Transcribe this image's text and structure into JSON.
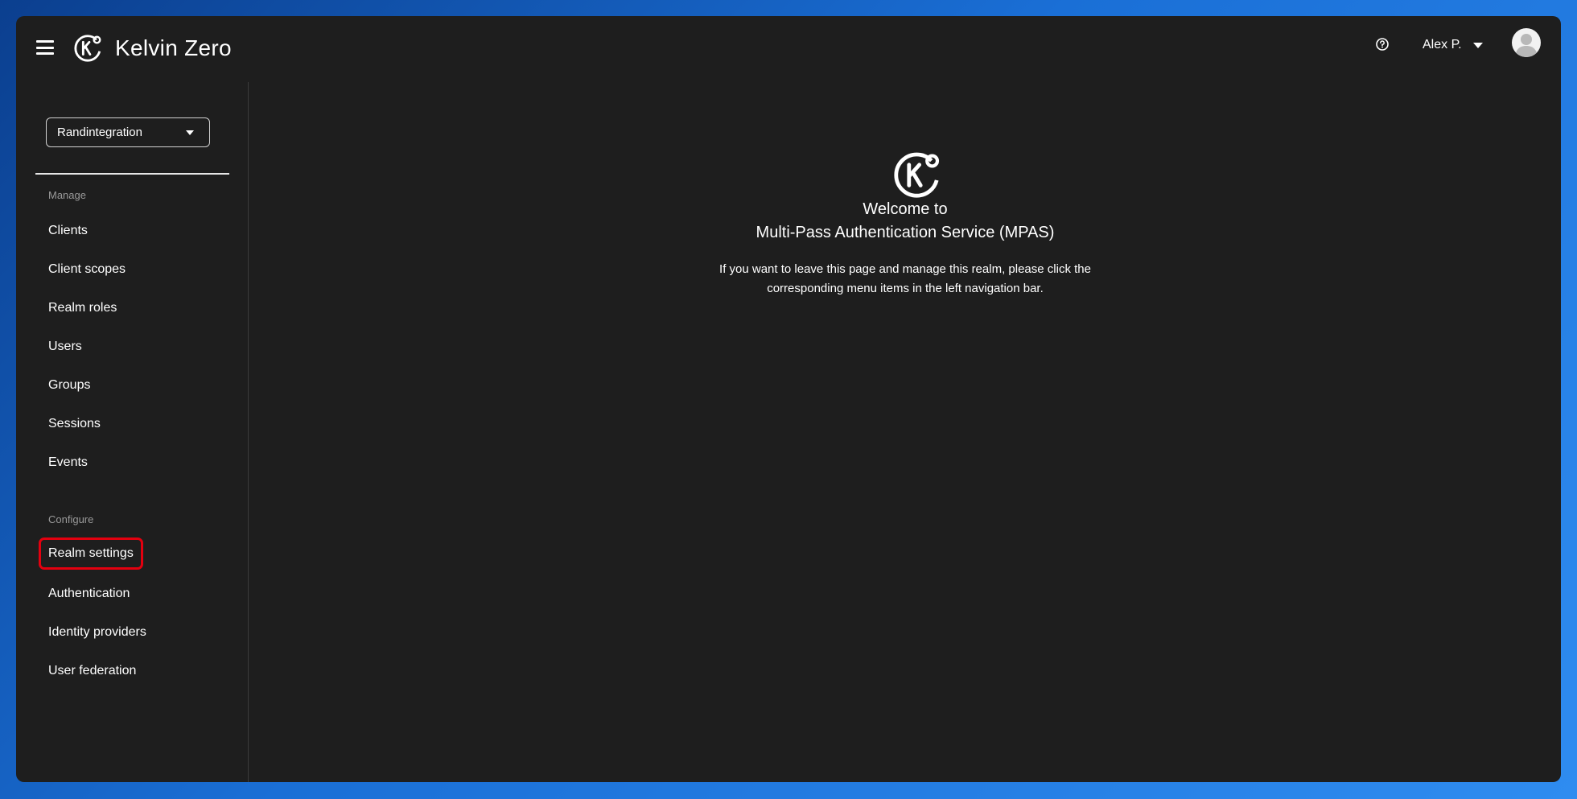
{
  "app": {
    "brand_name": "Kelvin Zero"
  },
  "header": {
    "user_name": "Alex P.",
    "icons": {
      "menu": "hamburger-icon",
      "help": "help-circle-icon",
      "avatar": "user-avatar-icon"
    }
  },
  "sidebar": {
    "realm_selector": {
      "value": "Randintegration"
    },
    "sections": [
      {
        "title": "Manage"
      },
      {
        "title": "Configure"
      }
    ],
    "manage_items": [
      {
        "label": "Clients"
      },
      {
        "label": "Client scopes"
      },
      {
        "label": "Realm roles"
      },
      {
        "label": "Users"
      },
      {
        "label": "Groups"
      },
      {
        "label": "Sessions"
      },
      {
        "label": "Events"
      }
    ],
    "configure_items": [
      {
        "label": "Realm settings",
        "selected": true
      },
      {
        "label": "Authentication"
      },
      {
        "label": "Identity providers"
      },
      {
        "label": "User federation"
      }
    ]
  },
  "main": {
    "welcome_line1": "Welcome to",
    "welcome_line2": "Multi-Pass Authentication Service (MPAS)",
    "description_line1": "If you want to leave this page and manage this realm, please click the",
    "description_line2": "corresponding menu items in the left navigation bar."
  },
  "colors": {
    "background": "#1e1e1e",
    "highlight": "#e3000f",
    "muted_text": "#9a9a9a"
  }
}
